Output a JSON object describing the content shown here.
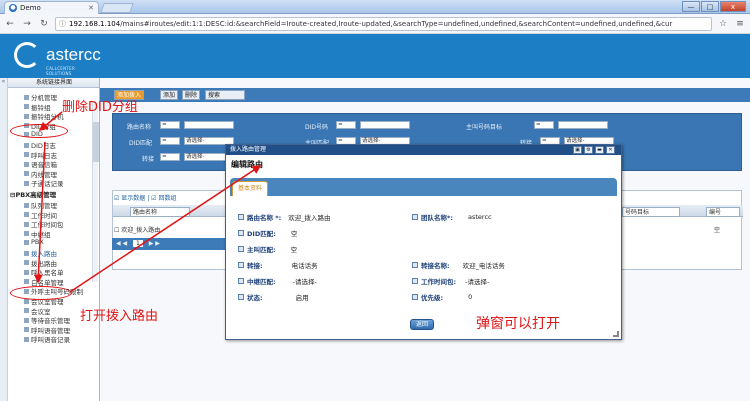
{
  "browser": {
    "tab_title": "Demo",
    "url_host": "192.168.1.104",
    "url_rest": "/mains#iroutes/edit:1:1:DESC:id:&searchField=Iroute-created,Iroute-updated,&searchType=undefined,undefined,&searchContent=undefined,undefined,&cur",
    "window_buttons": [
      "—",
      "□",
      "x"
    ]
  },
  "logo": {
    "name": "astercc",
    "tagline": "CALLCENTER SOLUTIONS"
  },
  "sidebar": {
    "title": "系统链接界面",
    "items_top": [
      "分机管理",
      "振铃组",
      "振铃组分机",
      "DID分组",
      "DID",
      "DID日志",
      "呼叫日志",
      "语音信箱",
      "内线管理",
      "子通话记录"
    ],
    "group": "PBX高级管理",
    "items_bottom": [
      "队列管理",
      "工作时间",
      "工作时间包",
      "中继组",
      "PBX",
      "拨入路由",
      "拨出路由",
      "呼入黑名单",
      "白名单管理",
      "外呼主叫号码限制",
      "会议室管理",
      "会议室",
      "等待音乐管理",
      "呼叫语音管理",
      "呼叫语音记录"
    ]
  },
  "toolbar": {
    "buttons": [
      "添加拨入",
      "添加",
      "删除",
      "搜索"
    ]
  },
  "filter": {
    "labels": [
      "路由名称",
      "DID号码",
      "主叫号码目标",
      "DID匹配",
      "主叫匹配",
      "转接",
      "转接",
      "中继组"
    ],
    "select_default": "请选择-",
    "eq": "="
  },
  "grid": {
    "tools": [
      "显示数据",
      "回数组"
    ],
    "header_select": "路由名称",
    "header_right": "号码目标",
    "header_right2": "编号",
    "row_text": "欢迎_拨入路由",
    "row_right": "空",
    "pager": "1"
  },
  "modal": {
    "title": "拨入路由管理",
    "subtitle": "编辑路由",
    "tab": "基本资料",
    "fields": [
      {
        "label": "路由名称 *:",
        "value": "欢迎_拨入路由"
      },
      {
        "label": "团队名称*:",
        "value": "astercc"
      },
      {
        "label": "DID匹配:",
        "value": "空"
      },
      {
        "label": "主叫匹配:",
        "value": "空"
      },
      {
        "label": "转接:",
        "value": "电话话务"
      },
      {
        "label": "转接名称:",
        "value": "欢迎_电话话务"
      },
      {
        "label": "中继匹配:",
        "value": "-请选择-"
      },
      {
        "label": "工作时间包:",
        "value": "-请选择-"
      },
      {
        "label": "状态:",
        "value": "启用"
      },
      {
        "label": "优先级:",
        "value": "0"
      }
    ],
    "back_label": "返回"
  },
  "annotations": {
    "delete_did": "删除DID分组",
    "open_route": "打开拨入路由",
    "popup_ok": "弹窗可以打开"
  },
  "colors": {
    "header": "#1c7fc6",
    "annotation": "#e01414"
  }
}
